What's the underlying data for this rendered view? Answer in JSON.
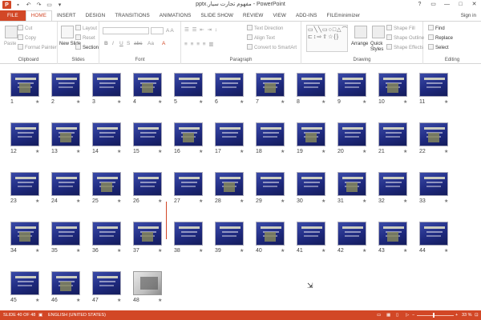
{
  "titlebar": {
    "app_icon": "P",
    "title": "pptx.مفهوم تجارت سیار - PowerPoint",
    "qa_icons": [
      "save-icon",
      "undo-icon",
      "redo-icon",
      "start-from-beginning-icon",
      "customize-icon"
    ],
    "controls": [
      "?",
      "▭",
      "—",
      "□",
      "✕"
    ]
  },
  "tabs": [
    "FILE",
    "HOME",
    "INSERT",
    "DESIGN",
    "TRANSITIONS",
    "ANIMATIONS",
    "SLIDE SHOW",
    "REVIEW",
    "VIEW",
    "ADD-INS",
    "FILEminimizer"
  ],
  "active_tab": "HOME",
  "signin": "Sign in",
  "ribbon": {
    "clipboard": {
      "label": "Clipboard",
      "paste": "Paste",
      "cut": "Cut",
      "copy": "Copy",
      "format_painter": "Format Painter"
    },
    "slides": {
      "label": "Slides",
      "new_slide": "New Slide",
      "layout": "Layout",
      "reset": "Reset",
      "section": "Section"
    },
    "font": {
      "label": "Font",
      "bold": "B",
      "italic": "I",
      "underline": "U",
      "shadow": "S",
      "strike": "abc",
      "aa": "Aa"
    },
    "paragraph": {
      "label": "Paragraph",
      "text_direction": "Text Direction",
      "align_text": "Align Text",
      "convert_smartart": "Convert to SmartArt"
    },
    "drawing": {
      "label": "Drawing",
      "arrange": "Arrange",
      "quick_styles": "Quick Styles",
      "shape_fill": "Shape Fill",
      "shape_outline": "Shape Outline",
      "shape_effects": "Shape Effects",
      "shapes_glyphs": "▭╲╲▭○□△⌒⟆⊏↕⇨⇧☆{}"
    },
    "editing": {
      "label": "Editing",
      "find": "Find",
      "replace": "Replace",
      "select": "Select"
    }
  },
  "slides": [
    {
      "num": "1",
      "photo": false
    },
    {
      "num": "2",
      "photo": false
    },
    {
      "num": "3",
      "photo": false
    },
    {
      "num": "4",
      "photo": false
    },
    {
      "num": "5",
      "photo": false
    },
    {
      "num": "6",
      "photo": false
    },
    {
      "num": "7",
      "photo": false
    },
    {
      "num": "8",
      "photo": false
    },
    {
      "num": "9",
      "photo": false
    },
    {
      "num": "10",
      "photo": false
    },
    {
      "num": "11",
      "photo": false
    },
    {
      "num": "12",
      "photo": false
    },
    {
      "num": "13",
      "photo": false
    },
    {
      "num": "14",
      "photo": false
    },
    {
      "num": "15",
      "photo": false
    },
    {
      "num": "16",
      "photo": false
    },
    {
      "num": "17",
      "photo": false
    },
    {
      "num": "18",
      "photo": false
    },
    {
      "num": "19",
      "photo": false
    },
    {
      "num": "20",
      "photo": false
    },
    {
      "num": "21",
      "photo": false
    },
    {
      "num": "22",
      "photo": false
    },
    {
      "num": "23",
      "photo": false
    },
    {
      "num": "24",
      "photo": false
    },
    {
      "num": "25",
      "photo": false
    },
    {
      "num": "26",
      "photo": false
    },
    {
      "num": "27",
      "photo": false
    },
    {
      "num": "28",
      "photo": false
    },
    {
      "num": "29",
      "photo": false
    },
    {
      "num": "30",
      "photo": false
    },
    {
      "num": "31",
      "photo": false
    },
    {
      "num": "32",
      "photo": false
    },
    {
      "num": "33",
      "photo": false
    },
    {
      "num": "34",
      "photo": false
    },
    {
      "num": "35",
      "photo": false
    },
    {
      "num": "36",
      "photo": false
    },
    {
      "num": "37",
      "photo": false
    },
    {
      "num": "38",
      "photo": false
    },
    {
      "num": "39",
      "photo": false
    },
    {
      "num": "40",
      "photo": false
    },
    {
      "num": "41",
      "photo": false
    },
    {
      "num": "42",
      "photo": false
    },
    {
      "num": "43",
      "photo": false
    },
    {
      "num": "44",
      "photo": false
    },
    {
      "num": "45",
      "photo": false
    },
    {
      "num": "46",
      "photo": false
    },
    {
      "num": "47",
      "photo": false
    },
    {
      "num": "48",
      "photo": true
    }
  ],
  "transition_marker": "★",
  "status": {
    "slide_info": "SLIDE 40 OF 48",
    "language": "ENGLISH (UNITED STATES)",
    "zoom": "33 %"
  },
  "colors": {
    "accent": "#d24726",
    "slide_bg": "#1f2a80"
  }
}
